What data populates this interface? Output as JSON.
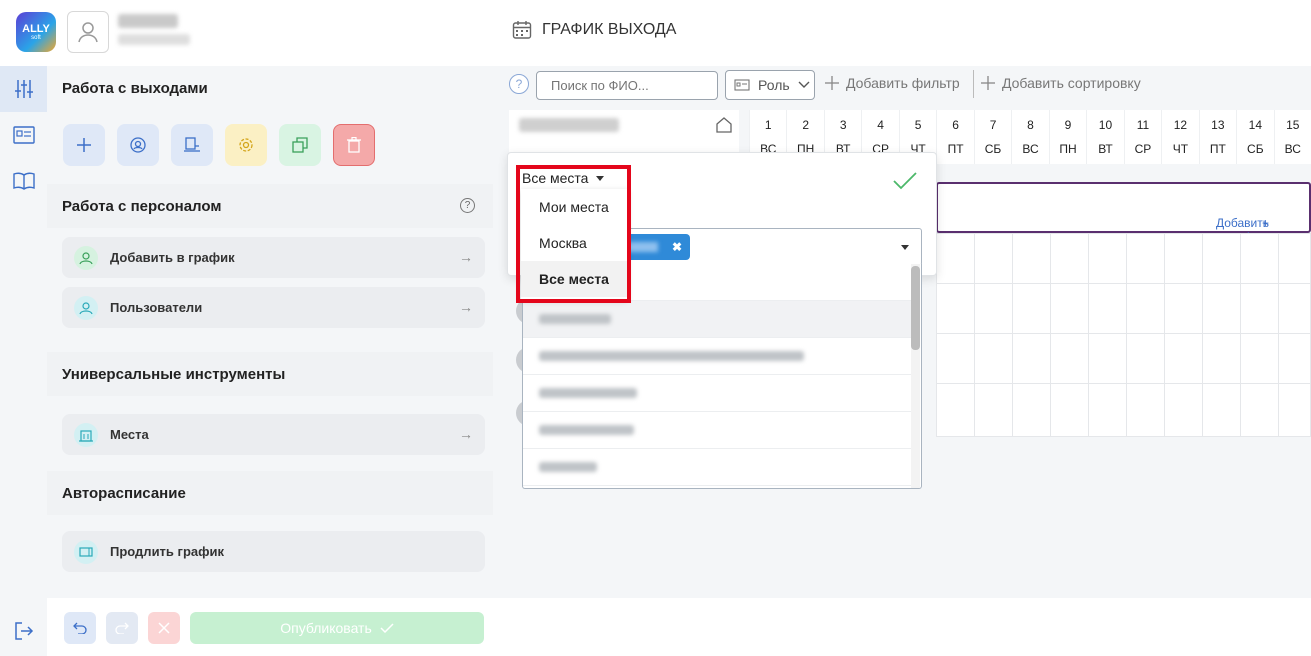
{
  "header": {
    "logo_text": "ALLY",
    "logo_sub": "soft",
    "page_title": "ГРАФИК ВЫХОДА"
  },
  "panel": {
    "section_exits": "Работа с выходами",
    "section_staff": "Работа с персоналом",
    "staff_items": [
      {
        "label": "Добавить в график"
      },
      {
        "label": "Пользователи"
      }
    ],
    "section_tools": "Универсальные инструменты",
    "tools_items": [
      {
        "label": "Места"
      }
    ],
    "section_auto": "Авторасписание",
    "auto_items": [
      {
        "label": "Продлить график"
      }
    ],
    "publish_label": "Опубликовать"
  },
  "filters": {
    "search_placeholder": "Поиск по ФИО...",
    "role_label": "Роль",
    "add_filter": "Добавить фильтр",
    "add_sort": "Добавить сортировку"
  },
  "calendar": {
    "days": [
      {
        "num": "1",
        "dow": "ВС"
      },
      {
        "num": "2",
        "dow": "ПН"
      },
      {
        "num": "3",
        "dow": "ВТ"
      },
      {
        "num": "4",
        "dow": "СР"
      },
      {
        "num": "5",
        "dow": "ЧТ"
      },
      {
        "num": "6",
        "dow": "ПТ"
      },
      {
        "num": "7",
        "dow": "СБ"
      },
      {
        "num": "8",
        "dow": "ВС"
      },
      {
        "num": "9",
        "dow": "ПН"
      },
      {
        "num": "10",
        "dow": "ВТ"
      },
      {
        "num": "11",
        "dow": "СР"
      },
      {
        "num": "12",
        "dow": "ЧТ"
      },
      {
        "num": "13",
        "dow": "ПТ"
      },
      {
        "num": "14",
        "dow": "СБ"
      },
      {
        "num": "15",
        "dow": "ВС"
      }
    ],
    "add_to_schedule": "Добавить в график"
  },
  "place_filter": {
    "selected": "Все места",
    "options": [
      "Мои места",
      "Москва",
      "Все места"
    ]
  },
  "colors": {
    "accent": "#2f8ad8",
    "highlight_frame": "#e4061b",
    "add_row_border": "#5a2f6f"
  }
}
